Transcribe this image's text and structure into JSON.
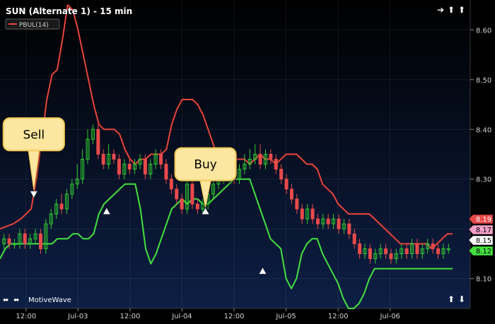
{
  "header": {
    "title": "SUN (Alternate 1) - 15 min",
    "legend_label": "PBUL(14)",
    "legend_color": "#e8443a"
  },
  "footer": {
    "brand": "MotiveWave"
  },
  "colors": {
    "background_top": "#000000",
    "background_bottom": "#0d1f45",
    "upper_band": "#e8443a",
    "lower_band": "#44e040",
    "bull_candle": "#33cc33",
    "bear_candle": "#e84a4a",
    "callout_fill": "#fde7a0",
    "callout_border": "#f2c85a"
  },
  "icons": {
    "top_right": [
      "arrow-right-icon",
      "arrow-up-icon",
      "arrow-up-icon"
    ],
    "bottom_left": [
      "double-arrow-icon",
      "double-arrow-icon"
    ],
    "bottom_right": [
      "arrow-up-icon",
      "arrow-down-icon"
    ]
  },
  "chart_data": {
    "type": "line",
    "title": "SUN (Alternate 1) - 15 min",
    "ylim": [
      8.04,
      8.66
    ],
    "y_ticks": [
      "8.60",
      "8.50",
      "8.40",
      "8.30",
      "8.20",
      "8.10"
    ],
    "x_ticks": [
      "12:00",
      "Jul-03",
      "12:00",
      "Jul-04",
      "12:00",
      "Jul-05",
      "12:00",
      "Jul-06"
    ],
    "x_tick_index": [
      10,
      30,
      50,
      70,
      90,
      110,
      130,
      150
    ],
    "price_labels": [
      {
        "text": "8.19",
        "value": 8.19,
        "fill": "#e84a4a",
        "color": "#ffffff"
      },
      {
        "text": "8.17",
        "value": 8.17,
        "fill": "#f5a0c8",
        "color": "#000000"
      },
      {
        "text": "8.15",
        "value": 8.15,
        "fill": "#ffffff",
        "color": "#000000"
      },
      {
        "text": "8.12",
        "value": 8.12,
        "fill": "#44e040",
        "color": "#000000"
      }
    ],
    "series": [
      {
        "name": "PBUL(14)",
        "color": "#e8443a",
        "x": [
          0,
          5,
          8,
          10,
          12,
          14,
          16,
          18,
          20,
          22,
          24,
          26,
          28,
          30,
          32,
          34,
          36,
          38,
          40,
          42,
          44,
          46,
          48,
          50,
          52,
          54,
          56,
          58,
          60,
          62,
          64,
          66,
          68,
          70,
          72,
          74,
          76,
          78,
          80,
          82,
          84,
          86,
          88,
          90,
          92,
          94,
          96,
          98,
          100,
          102,
          104,
          106,
          108,
          110,
          112,
          114,
          116,
          118,
          120,
          122,
          124,
          126,
          128,
          130,
          132,
          134,
          136,
          138,
          140,
          142,
          144,
          146,
          148,
          150,
          152,
          154,
          156,
          158,
          160,
          162,
          164,
          166,
          168,
          170,
          172,
          174
        ],
        "y": [
          8.2,
          8.21,
          8.22,
          8.23,
          8.24,
          8.3,
          8.38,
          8.46,
          8.51,
          8.52,
          8.58,
          8.65,
          8.64,
          8.6,
          8.55,
          8.5,
          8.45,
          8.41,
          8.4,
          8.4,
          8.4,
          8.39,
          8.36,
          8.34,
          8.33,
          8.34,
          8.34,
          8.35,
          8.35,
          8.35,
          8.36,
          8.41,
          8.44,
          8.46,
          8.46,
          8.46,
          8.45,
          8.43,
          8.4,
          8.37,
          8.34,
          8.33,
          8.33,
          8.34,
          8.34,
          8.34,
          8.33,
          8.34,
          8.35,
          8.34,
          8.34,
          8.33,
          8.34,
          8.35,
          8.35,
          8.35,
          8.34,
          8.33,
          8.33,
          8.32,
          8.29,
          8.28,
          8.27,
          8.25,
          8.24,
          8.23,
          8.23,
          8.23,
          8.23,
          8.23,
          8.22,
          8.21,
          8.2,
          8.19,
          8.18,
          8.17,
          8.17,
          8.17,
          8.17,
          8.17,
          8.17,
          8.16,
          8.17,
          8.18,
          8.19,
          8.19
        ]
      },
      {
        "name": "",
        "color": "#44e040",
        "x": [
          0,
          2,
          4,
          6,
          8,
          10,
          12,
          14,
          16,
          18,
          20,
          22,
          24,
          26,
          28,
          30,
          32,
          34,
          36,
          38,
          40,
          42,
          44,
          46,
          48,
          50,
          52,
          54,
          56,
          58,
          60,
          62,
          64,
          66,
          68,
          70,
          72,
          74,
          76,
          78,
          80,
          82,
          84,
          86,
          88,
          90,
          92,
          94,
          96,
          98,
          100,
          102,
          104,
          106,
          108,
          110,
          112,
          114,
          116,
          118,
          120,
          122,
          124,
          126,
          128,
          130,
          132,
          134,
          136,
          138,
          140,
          142,
          144,
          146,
          148,
          150,
          152,
          154,
          156,
          158,
          160,
          162,
          164,
          166,
          168,
          170,
          172,
          174
        ],
        "y": [
          8.14,
          8.16,
          8.17,
          8.17,
          8.17,
          8.17,
          8.17,
          8.17,
          8.17,
          8.17,
          8.17,
          8.18,
          8.18,
          8.18,
          8.19,
          8.19,
          8.18,
          8.18,
          8.19,
          8.23,
          8.25,
          8.26,
          8.27,
          8.28,
          8.29,
          8.29,
          8.29,
          8.24,
          8.16,
          8.13,
          8.15,
          8.18,
          8.21,
          8.24,
          8.25,
          8.26,
          8.25,
          8.26,
          8.26,
          8.25,
          8.25,
          8.26,
          8.27,
          8.28,
          8.29,
          8.3,
          8.3,
          8.3,
          8.3,
          8.27,
          8.24,
          8.21,
          8.18,
          8.17,
          8.16,
          8.1,
          8.08,
          8.1,
          8.15,
          8.17,
          8.18,
          8.18,
          8.15,
          8.13,
          8.11,
          8.09,
          8.06,
          8.04,
          8.04,
          8.05,
          8.07,
          8.1,
          8.12,
          8.12,
          8.12,
          8.12,
          8.12,
          8.12,
          8.12,
          8.12,
          8.12,
          8.12,
          8.12,
          8.12,
          8.12,
          8.12,
          8.12,
          8.12
        ]
      }
    ],
    "candles": [
      [
        8.17,
        8.18,
        8.19,
        8.16
      ],
      [
        8.18,
        8.17,
        8.19,
        8.16
      ],
      [
        8.17,
        8.17,
        8.18,
        8.16
      ],
      [
        8.17,
        8.19,
        8.2,
        8.16
      ],
      [
        8.19,
        8.17,
        8.2,
        8.16
      ],
      [
        8.17,
        8.18,
        8.19,
        8.16
      ],
      [
        8.18,
        8.19,
        8.2,
        8.17
      ],
      [
        8.19,
        8.16,
        8.2,
        8.15
      ],
      [
        8.16,
        8.21,
        8.22,
        8.15
      ],
      [
        8.21,
        8.23,
        8.24,
        8.2
      ],
      [
        8.23,
        8.25,
        8.26,
        8.22
      ],
      [
        8.25,
        8.24,
        8.27,
        8.23
      ],
      [
        8.24,
        8.27,
        8.28,
        8.23
      ],
      [
        8.27,
        8.29,
        8.3,
        8.26
      ],
      [
        8.29,
        8.3,
        8.33,
        8.28
      ],
      [
        8.3,
        8.34,
        8.36,
        8.29
      ],
      [
        8.34,
        8.38,
        8.4,
        8.33
      ],
      [
        8.38,
        8.4,
        8.41,
        8.37
      ],
      [
        8.4,
        8.35,
        8.41,
        8.34
      ],
      [
        8.35,
        8.33,
        8.36,
        8.32
      ],
      [
        8.33,
        8.35,
        8.37,
        8.32
      ],
      [
        8.35,
        8.34,
        8.36,
        8.33
      ],
      [
        8.34,
        8.31,
        8.35,
        8.3
      ],
      [
        8.31,
        8.33,
        8.34,
        8.3
      ],
      [
        8.33,
        8.32,
        8.34,
        8.31
      ],
      [
        8.32,
        8.33,
        8.34,
        8.31
      ],
      [
        8.33,
        8.34,
        8.35,
        8.32
      ],
      [
        8.34,
        8.31,
        8.35,
        8.3
      ],
      [
        8.31,
        8.33,
        8.34,
        8.3
      ],
      [
        8.33,
        8.35,
        8.36,
        8.32
      ],
      [
        8.35,
        8.33,
        8.36,
        8.32
      ],
      [
        8.33,
        8.3,
        8.34,
        8.29
      ],
      [
        8.3,
        8.28,
        8.31,
        8.27
      ],
      [
        8.28,
        8.26,
        8.29,
        8.25
      ],
      [
        8.26,
        8.24,
        8.27,
        8.23
      ],
      [
        8.24,
        8.29,
        8.3,
        8.23
      ],
      [
        8.29,
        8.25,
        8.3,
        8.24
      ],
      [
        8.25,
        8.24,
        8.26,
        8.23
      ],
      [
        8.24,
        8.25,
        8.26,
        8.23
      ],
      [
        8.25,
        8.27,
        8.28,
        8.24
      ],
      [
        8.27,
        8.29,
        8.3,
        8.26
      ],
      [
        8.29,
        8.3,
        8.31,
        8.28
      ],
      [
        8.3,
        8.31,
        8.32,
        8.29
      ],
      [
        8.31,
        8.32,
        8.33,
        8.3
      ],
      [
        8.32,
        8.3,
        8.33,
        8.29
      ],
      [
        8.3,
        8.32,
        8.33,
        8.29
      ],
      [
        8.32,
        8.33,
        8.35,
        8.31
      ],
      [
        8.33,
        8.34,
        8.36,
        8.32
      ],
      [
        8.34,
        8.35,
        8.37,
        8.33
      ],
      [
        8.35,
        8.33,
        8.37,
        8.32
      ],
      [
        8.33,
        8.35,
        8.36,
        8.32
      ],
      [
        8.35,
        8.34,
        8.36,
        8.33
      ],
      [
        8.34,
        8.32,
        8.35,
        8.31
      ],
      [
        8.32,
        8.3,
        8.33,
        8.29
      ],
      [
        8.3,
        8.28,
        8.31,
        8.27
      ],
      [
        8.28,
        8.26,
        8.29,
        8.25
      ],
      [
        8.26,
        8.24,
        8.27,
        8.23
      ],
      [
        8.24,
        8.22,
        8.25,
        8.21
      ],
      [
        8.22,
        8.24,
        8.25,
        8.21
      ],
      [
        8.24,
        8.22,
        8.25,
        8.21
      ],
      [
        8.22,
        8.21,
        8.23,
        8.2
      ],
      [
        8.21,
        8.22,
        8.23,
        8.2
      ],
      [
        8.22,
        8.21,
        8.23,
        8.2
      ],
      [
        8.21,
        8.22,
        8.23,
        8.2
      ],
      [
        8.22,
        8.2,
        8.23,
        8.19
      ],
      [
        8.2,
        8.21,
        8.22,
        8.19
      ],
      [
        8.21,
        8.19,
        8.22,
        8.18
      ],
      [
        8.19,
        8.17,
        8.2,
        8.16
      ],
      [
        8.17,
        8.15,
        8.18,
        8.14
      ],
      [
        8.15,
        8.16,
        8.17,
        8.14
      ],
      [
        8.16,
        8.14,
        8.17,
        8.13
      ],
      [
        8.14,
        8.15,
        8.16,
        8.13
      ],
      [
        8.15,
        8.16,
        8.17,
        8.14
      ],
      [
        8.16,
        8.15,
        8.17,
        8.14
      ],
      [
        8.15,
        8.14,
        8.16,
        8.13
      ],
      [
        8.14,
        8.15,
        8.16,
        8.13
      ],
      [
        8.15,
        8.16,
        8.17,
        8.14
      ],
      [
        8.16,
        8.15,
        8.17,
        8.14
      ],
      [
        8.15,
        8.17,
        8.18,
        8.14
      ],
      [
        8.17,
        8.15,
        8.18,
        8.14
      ],
      [
        8.15,
        8.16,
        8.17,
        8.14
      ],
      [
        8.16,
        8.17,
        8.18,
        8.15
      ],
      [
        8.17,
        8.16,
        8.18,
        8.15
      ],
      [
        8.16,
        8.15,
        8.17,
        8.14
      ],
      [
        8.15,
        8.16,
        8.17,
        8.14
      ],
      [
        8.16,
        8.16,
        8.17,
        8.15
      ]
    ],
    "annotations": [
      {
        "text": "Sell",
        "x": 13,
        "y": 8.39,
        "point_y": 8.27,
        "direction": "down"
      },
      {
        "text": "Buy",
        "x": 79,
        "y": 8.33,
        "point_y": 8.235,
        "direction": "up"
      }
    ],
    "signal_markers": [
      {
        "x": 13,
        "y": 8.27,
        "direction": "down"
      },
      {
        "x": 41,
        "y": 8.235,
        "direction": "up"
      },
      {
        "x": 79,
        "y": 8.235,
        "direction": "up"
      },
      {
        "x": 101,
        "y": 8.115,
        "direction": "up"
      }
    ]
  }
}
